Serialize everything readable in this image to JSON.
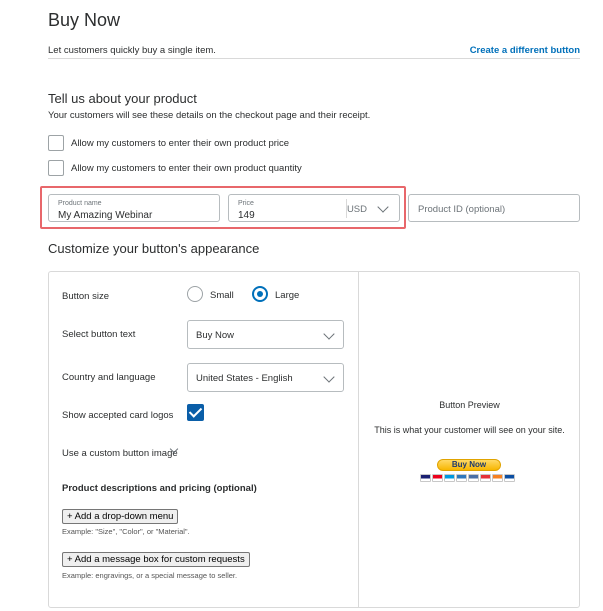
{
  "header": {
    "title": "Buy Now",
    "subtitle": "Let customers quickly buy a single item.",
    "create_link": "Create a different button"
  },
  "product": {
    "section_title": "Tell us about your product",
    "section_subtitle": "Your customers will see these details on the checkout page and their receipt.",
    "options": [
      {
        "label": "Allow my customers to enter their own product price",
        "checked": false
      },
      {
        "label": "Allow my customers to enter their own product quantity",
        "checked": false
      }
    ],
    "name_label": "Product name",
    "name_value": "My Amazing Webinar",
    "price_label": "Price",
    "price_value": "149",
    "currency": "USD",
    "product_id_placeholder": "Product ID (optional)"
  },
  "customize": {
    "section_title": "Customize your button's appearance",
    "button_size_label": "Button size",
    "size_small": "Small",
    "size_large": "Large",
    "size_selected": "Large",
    "button_text_label": "Select button text",
    "button_text_value": "Buy Now",
    "country_label": "Country and language",
    "country_value": "United States - English",
    "card_logos_label": "Show accepted card logos",
    "card_logos_checked": true,
    "custom_image_label": "Use a custom button image",
    "descriptions_heading": "Product descriptions and pricing (optional)",
    "dropdown_button": "+ Add a drop-down menu",
    "dropdown_example": "Example: \"Size\", \"Color\", or \"Material\".",
    "message_button": "+ Add a message box for custom requests",
    "message_example": "Example: engravings, or a special message to seller."
  },
  "preview": {
    "title": "Button Preview",
    "subtitle": "This is what your customer will see on your site.",
    "button_label": "Buy Now",
    "card_logos": [
      "visa-logo",
      "mastercard-logo",
      "maestro-logo",
      "amex-logo",
      "bank-logo",
      "ebay-logo",
      "discover-logo",
      "jcb-logo"
    ],
    "card_colors": [
      "#1a1f71",
      "#eb001b",
      "#0099df",
      "#2e77bc",
      "#4a6fa5",
      "#e53238",
      "#f68121",
      "#0b4ea2"
    ]
  },
  "colors": {
    "accent": "#0070ba",
    "highlight": "#e8676b",
    "checked": "#0a5ea8",
    "paypal_yellow": "#ffc439"
  }
}
